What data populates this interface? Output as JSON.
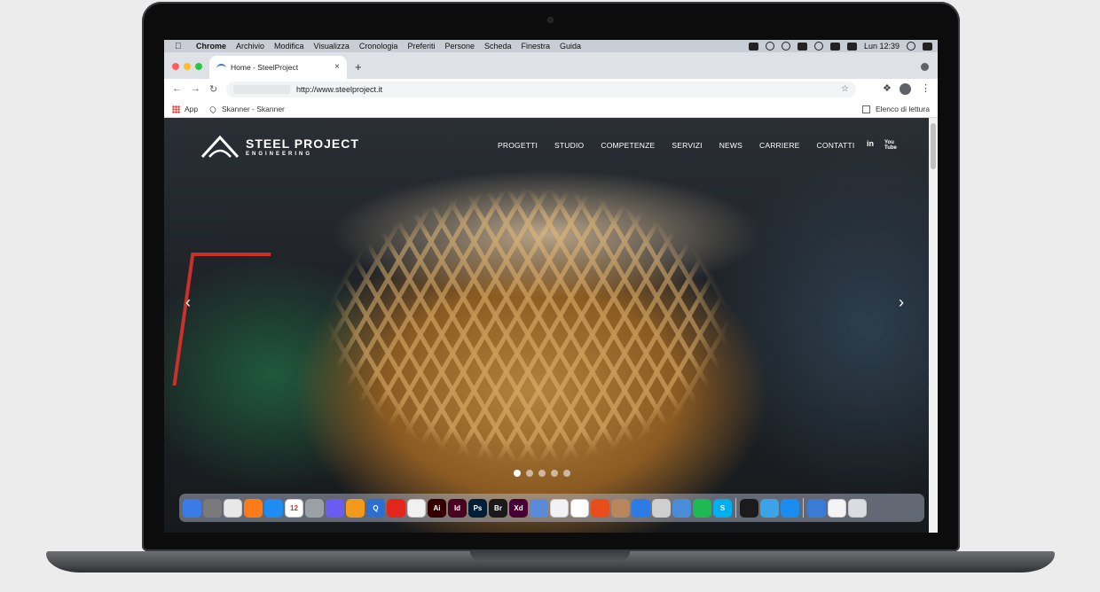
{
  "menubar": {
    "app": "Chrome",
    "items": [
      "Archivio",
      "Modifica",
      "Visualizza",
      "Cronologia",
      "Preferiti",
      "Persone",
      "Scheda",
      "Finestra",
      "Guida"
    ],
    "clock": "Lun 12:39"
  },
  "browser": {
    "tab_title": "Home - SteelProject",
    "close_glyph": "×",
    "new_tab_glyph": "+",
    "url": "http://www.steelproject.it",
    "back_glyph": "←",
    "forward_glyph": "→",
    "reload_glyph": "↻",
    "star_glyph": "☆",
    "menu_glyph": "⋮",
    "bookmarks": [
      {
        "label": "App"
      },
      {
        "label": "Skanner - Skanner"
      }
    ],
    "reading_list": "Elenco di lettura"
  },
  "site": {
    "brand": "STEEL PROJECT",
    "tagline": "ENGINEERING",
    "nav": [
      "PROGETTI",
      "STUDIO",
      "COMPETENZE",
      "SERVIZI",
      "NEWS",
      "CARRIERE",
      "CONTATTI"
    ],
    "social": [
      "in",
      "You Tube"
    ],
    "prev_glyph": "‹",
    "next_glyph": "›",
    "slides": 5,
    "active_slide": 1
  },
  "dock": {
    "apps": [
      {
        "label": "",
        "color": "#3b7be8"
      },
      {
        "label": "",
        "color": "#7a7a7a"
      },
      {
        "label": "",
        "color": "#e8e8e8"
      },
      {
        "label": "",
        "color": "#ff7b1a"
      },
      {
        "label": "",
        "color": "#1e8cf0"
      },
      {
        "label": "12",
        "color": "#ffffff"
      },
      {
        "label": "",
        "color": "#9aa0a6"
      },
      {
        "label": "",
        "color": "#6a5cf0"
      },
      {
        "label": "",
        "color": "#f39a1c"
      },
      {
        "label": "Q",
        "color": "#2b6fd1"
      },
      {
        "label": "",
        "color": "#e3261c"
      },
      {
        "label": "",
        "color": "#f0f0f0"
      },
      {
        "label": "Ai",
        "color": "#330000"
      },
      {
        "label": "Id",
        "color": "#49021f"
      },
      {
        "label": "Ps",
        "color": "#001e36"
      },
      {
        "label": "Br",
        "color": "#1a1a1a"
      },
      {
        "label": "Xd",
        "color": "#470137"
      },
      {
        "label": "",
        "color": "#5b8bd6"
      },
      {
        "label": "",
        "color": "#f2f2f2"
      },
      {
        "label": "",
        "color": "#ffffff"
      },
      {
        "label": "",
        "color": "#e84e1b"
      },
      {
        "label": "",
        "color": "#b8865a"
      },
      {
        "label": "",
        "color": "#2c7be5"
      },
      {
        "label": "",
        "color": "#cfcfcf"
      },
      {
        "label": "",
        "color": "#4b8cd6"
      },
      {
        "label": "",
        "color": "#1db954"
      },
      {
        "label": "S",
        "color": "#00aff0"
      },
      {
        "label": "",
        "color": "#1b1b1b"
      },
      {
        "label": "",
        "color": "#3ba4e8"
      },
      {
        "label": "",
        "color": "#1a8cf0"
      },
      {
        "label": "",
        "color": "#3a7bd5"
      },
      {
        "label": "",
        "color": "#f4f4f4"
      },
      {
        "label": "",
        "color": "#d9dde3"
      }
    ]
  }
}
